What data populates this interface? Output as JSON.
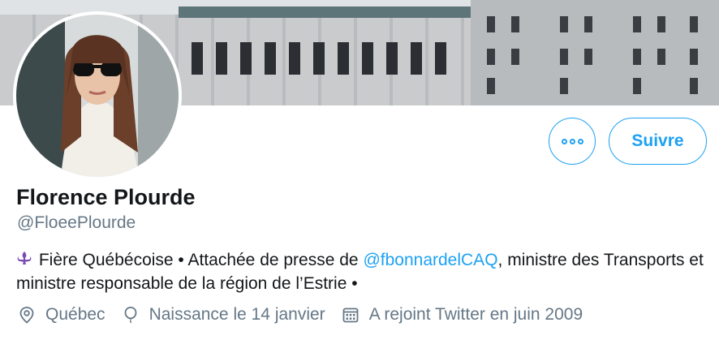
{
  "profile": {
    "name": "Florence Plourde",
    "handle": "@FloeePlourde",
    "bio": {
      "emoji_icon": "fleur-de-lis-icon",
      "text_before_mention": "Fière Québécoise • Attachée de presse de ",
      "mention": "@fbonnardelCAQ",
      "text_after_mention": ", ministre des Transports et ministre responsable de la région de l’Estrie •"
    },
    "meta": {
      "location": "Québec",
      "birthday": "Naissance le 14 janvier",
      "joined": "A rejoint Twitter en juin 2009"
    }
  },
  "actions": {
    "more_icon": "more-options-icon",
    "follow_label": "Suivre"
  },
  "colors": {
    "accent": "#1da1f2",
    "text_primary": "#14171a",
    "text_secondary": "#657786",
    "fleur": "#7b4cb1"
  },
  "icons": {
    "location": "location-pin-icon",
    "birthday": "balloon-icon",
    "joined": "calendar-icon"
  }
}
